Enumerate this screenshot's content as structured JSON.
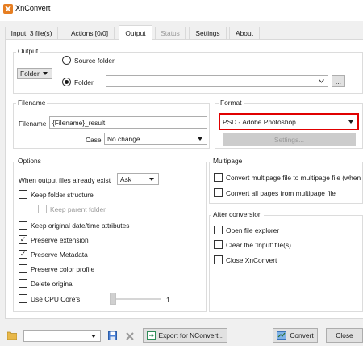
{
  "window": {
    "title": "XnConvert"
  },
  "tabs": [
    {
      "label": "Input: 3 file(s)"
    },
    {
      "label": "Actions [0/0]"
    },
    {
      "label": "Output"
    },
    {
      "label": "Status"
    },
    {
      "label": "Settings"
    },
    {
      "label": "About"
    }
  ],
  "output": {
    "group_label": "Output",
    "folder_type": "Folder",
    "source_folder_label": "Source folder",
    "folder_label": "Folder",
    "folder_path": "",
    "browse_label": "..."
  },
  "filename": {
    "group_label": "Filename",
    "field_label": "Filename",
    "value": "{Filename}_result",
    "case_label": "Case",
    "case_value": "No change"
  },
  "format": {
    "group_label": "Format",
    "value": "PSD - Adobe Photoshop",
    "settings_label": "Settings..."
  },
  "options": {
    "group_label": "Options",
    "exists_label": "When output files already exist",
    "exists_value": "Ask",
    "items": [
      {
        "label": "Keep folder structure",
        "checked": false
      },
      {
        "label": "Keep parent folder",
        "checked": false
      },
      {
        "label": "Keep original date/time attributes",
        "checked": false
      },
      {
        "label": "Preserve extension",
        "checked": true
      },
      {
        "label": "Preserve Metadata",
        "checked": true
      },
      {
        "label": "Preserve color profile",
        "checked": false
      },
      {
        "label": "Delete original",
        "checked": false
      },
      {
        "label": "Use CPU Core's",
        "checked": false
      }
    ],
    "cpu_cores_value": "1",
    "check_mark": "✓"
  },
  "multipage": {
    "group_label": "Multipage",
    "items": [
      {
        "label": "Convert multipage file to multipage file (when",
        "checked": false
      },
      {
        "label": "Convert all pages from multipage file",
        "checked": false
      }
    ]
  },
  "after_conversion": {
    "group_label": "After conversion",
    "items": [
      {
        "label": "Open file explorer",
        "checked": false
      },
      {
        "label": "Clear the 'Input' file(s)",
        "checked": false
      },
      {
        "label": "Close XnConvert",
        "checked": false
      }
    ]
  },
  "bottom": {
    "preset_value": "",
    "export_label": "Export for NConvert...",
    "convert_label": "Convert",
    "close_label": "Close"
  },
  "colors": {
    "highlight_border": "#e00000",
    "accent": "#0078d7"
  }
}
